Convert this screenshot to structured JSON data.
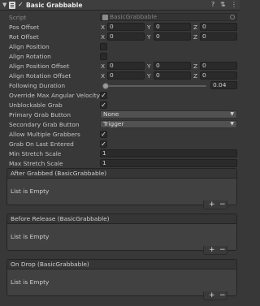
{
  "header": {
    "fold_glyph": "▼",
    "enabled_glyph": "✓",
    "title": "Basic Grabbable",
    "help_glyph": "?",
    "preset_glyph": "⇅",
    "menu_glyph": "⋮"
  },
  "script": {
    "label": "Script",
    "value": "BasicGrabbable"
  },
  "axes": {
    "x": "X",
    "y": "Y",
    "z": "Z"
  },
  "pos_offset": {
    "label": "Pos Offset",
    "x": "0",
    "y": "0",
    "z": "0"
  },
  "rot_offset": {
    "label": "Rot Offset",
    "x": "0",
    "y": "0",
    "z": "0"
  },
  "align_position": {
    "label": "Align Position",
    "checked": false
  },
  "align_rotation": {
    "label": "Align Rotation",
    "checked": false
  },
  "align_position_offset": {
    "label": "Align Position Offset",
    "x": "0",
    "y": "0",
    "z": "0"
  },
  "align_rotation_offset": {
    "label": "Align Rotation Offset",
    "x": "0",
    "y": "0",
    "z": "0"
  },
  "following_duration": {
    "label": "Following Duration",
    "value": "0.04",
    "slider_fraction": 0.0
  },
  "override_max_angular_velocity": {
    "label": "Override Max Angular Velocity",
    "check": "✓"
  },
  "unblockable_grab": {
    "label": "Unblockable Grab",
    "check": "✓"
  },
  "primary_grab_button": {
    "label": "Primary Grab Button",
    "value": "None"
  },
  "secondary_grab_button": {
    "label": "Secondary Grab Button",
    "value": "Trigger"
  },
  "dropdown_arrow": "▼",
  "allow_multiple_grabbers": {
    "label": "Allow Multiple Grabbers",
    "check": "✓"
  },
  "grab_on_last_entered": {
    "label": "Grab On Last Entered",
    "check": "✓"
  },
  "min_stretch_scale": {
    "label": "Min Stretch Scale",
    "value": "1"
  },
  "max_stretch_scale": {
    "label": "Max Stretch Scale",
    "value": "1"
  },
  "events": [
    {
      "title": "After Grabbed (BasicGrabbable)",
      "empty_text": "List is Empty",
      "plus": "+",
      "minus": "−"
    },
    {
      "title": "Before Release (BasicGrabbable)",
      "empty_text": "List is Empty",
      "plus": "+",
      "minus": "−"
    },
    {
      "title": "On Drop (BasicGrabbable)",
      "empty_text": "List is Empty",
      "plus": "+",
      "minus": "−"
    }
  ]
}
